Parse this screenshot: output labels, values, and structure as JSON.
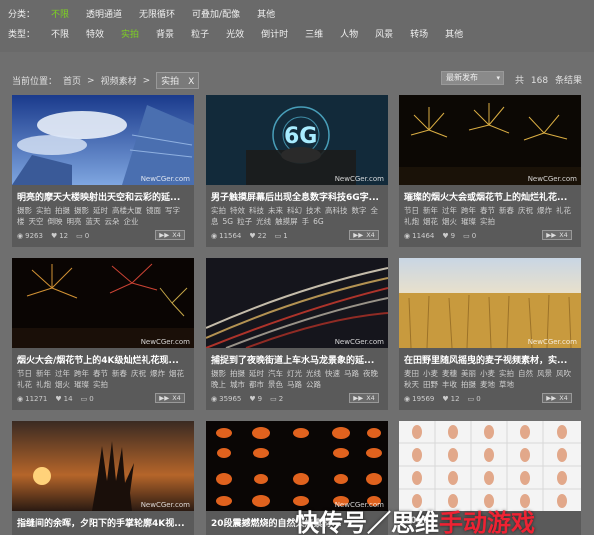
{
  "filters": {
    "category": {
      "label": "分类：",
      "items": [
        "不限",
        "透明通道",
        "无限循环",
        "可叠加/配像",
        "其他"
      ],
      "active_index": 0
    },
    "type": {
      "label": "类型：",
      "items": [
        "不限",
        "特效",
        "实拍",
        "背景",
        "粒子",
        "光效",
        "倒计时",
        "三维",
        "人物",
        "风景",
        "转场",
        "其他"
      ],
      "active_index": 2
    }
  },
  "breadcrumb": {
    "prefix": "当前位置：",
    "home": "首页",
    "sep": ">",
    "section": "视频素材",
    "current": "实拍",
    "close_glyph": "X"
  },
  "sort": {
    "value": "最新发布",
    "caret": "▾"
  },
  "count": {
    "prefix": "共",
    "value": "168",
    "suffix": "条结果"
  },
  "watermark_text": "NewCGer.com",
  "cards": [
    {
      "title": "明亮的摩天大楼映射出天空和云彩的延...",
      "tags": [
        "摄影",
        "实拍",
        "拍摄",
        "摄影",
        "延时",
        "高楼大厦",
        "镜面",
        "写字楼",
        "天空",
        "倒映",
        "明亮",
        "蓝天",
        "云朵",
        "企业"
      ],
      "views": "9263",
      "likes": "12",
      "comments": "0",
      "badge": "X4"
    },
    {
      "title": "男子触摸屏幕后出现全息数字科技6G字...",
      "tags": [
        "实拍",
        "特效",
        "科技",
        "未来",
        "科幻",
        "技术",
        "高科技",
        "数字",
        "全息",
        "5G",
        "粒子",
        "光线",
        "触摸屏",
        "手",
        "6G"
      ],
      "views": "11564",
      "likes": "22",
      "comments": "1",
      "badge": "X4"
    },
    {
      "title": "璀璨的烟火大会或烟花节上的灿烂礼花...",
      "tags": [
        "节日",
        "新年",
        "过年",
        "跨年",
        "春节",
        "新春",
        "庆祝",
        "爆炸",
        "礼花",
        "礼炮",
        "烟花",
        "烟火",
        "璀璨",
        "实拍"
      ],
      "views": "11464",
      "likes": "9",
      "comments": "0",
      "badge": "X4"
    },
    {
      "title": "烟火大会/烟花节上的4K级灿烂礼花现...",
      "tags": [
        "节日",
        "新年",
        "过年",
        "跨年",
        "春节",
        "新春",
        "庆祝",
        "爆炸",
        "烟花",
        "礼花",
        "礼炮",
        "烟火",
        "璀璨",
        "实拍"
      ],
      "views": "11271",
      "likes": "14",
      "comments": "0",
      "badge": "X4"
    },
    {
      "title": "捕捉到了夜晚街道上车水马龙景象的延...",
      "tags": [
        "摄影",
        "拍摄",
        "延时",
        "汽车",
        "灯光",
        "光线",
        "快速",
        "马路",
        "夜晚",
        "晚上",
        "城市",
        "都市",
        "景色",
        "马路",
        "公路"
      ],
      "views": "35965",
      "likes": "9",
      "comments": "2",
      "badge": "X4"
    },
    {
      "title": "在田野里随风摇曳的麦子视频素材，实...",
      "tags": [
        "麦田",
        "小麦",
        "麦穗",
        "美丽",
        "小麦",
        "实拍",
        "自然",
        "风景",
        "风吹",
        "秋天",
        "田野",
        "丰收",
        "拍摄",
        "麦地",
        "草地"
      ],
      "views": "19569",
      "likes": "12",
      "comments": "0",
      "badge": "X4"
    },
    {
      "title": "指缝间的余晖，夕阳下的手掌轮廓4K视...",
      "tags": [],
      "views": "",
      "likes": "",
      "comments": "",
      "badge": ""
    },
    {
      "title": "20段震撼燃烧的自然火焰素材...",
      "tags": [],
      "views": "",
      "likes": "",
      "comments": "",
      "badge": ""
    },
    {
      "title": "20...",
      "tags": [],
      "views": "",
      "likes": "",
      "comments": "",
      "badge": ""
    }
  ],
  "bottom_watermark": {
    "text": "快传号／思维",
    "accent": "手动游戏"
  },
  "colors": {
    "active_filter": "#7ed321",
    "background": "#6f6f6f",
    "card_bg": "#5a5a5a"
  }
}
